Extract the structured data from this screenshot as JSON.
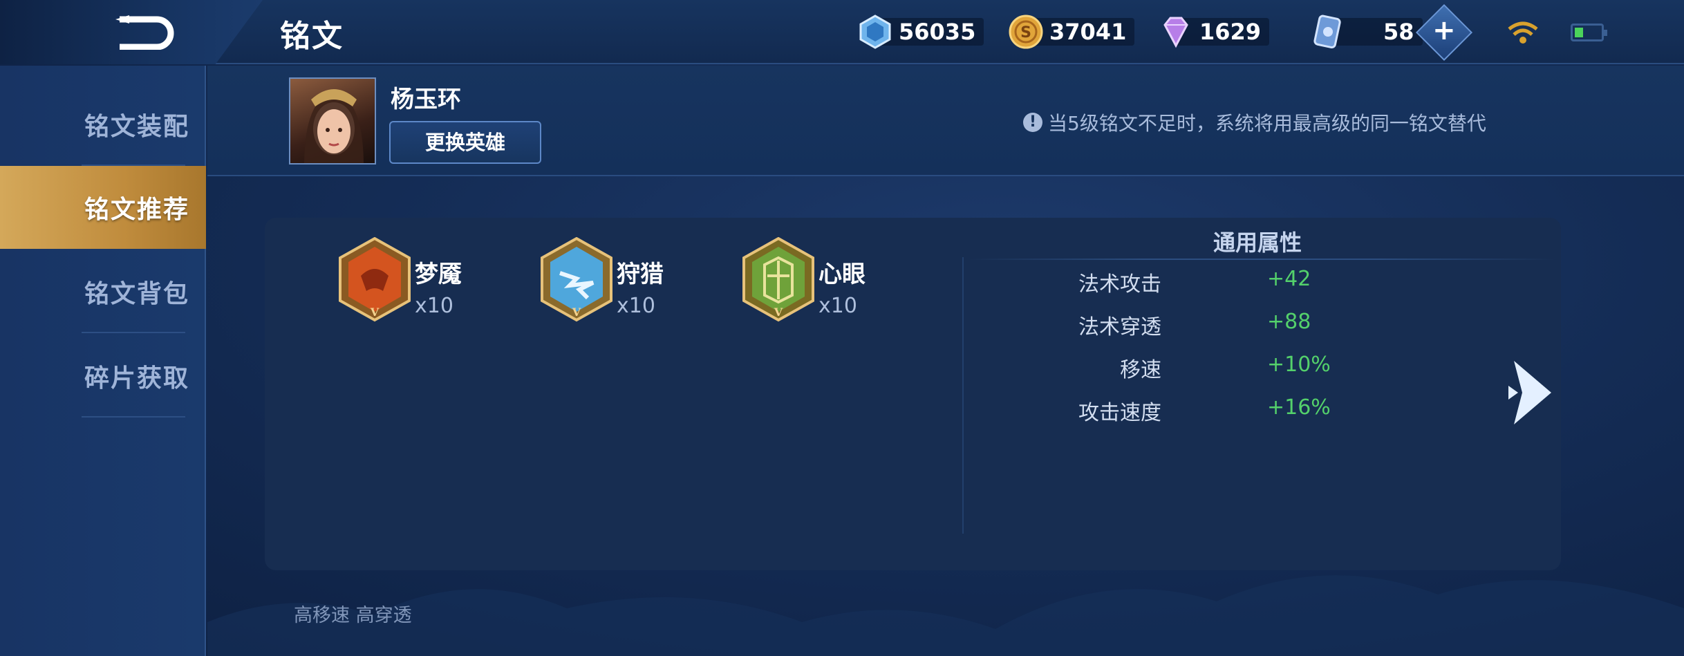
{
  "header": {
    "title": "铭文",
    "currencies": [
      {
        "icon": "diamond-crystal-icon",
        "amount": "56035"
      },
      {
        "icon": "gold-coin-icon",
        "amount": "37041"
      },
      {
        "icon": "purple-gem-icon",
        "amount": "1629"
      },
      {
        "icon": "ticket-card-icon",
        "amount": "58"
      }
    ]
  },
  "sidebar": {
    "items": [
      {
        "label": "铭文装配",
        "active": false
      },
      {
        "label": "铭文推荐",
        "active": true
      },
      {
        "label": "铭文背包",
        "active": false
      },
      {
        "label": "碎片获取",
        "active": false
      }
    ]
  },
  "hero": {
    "name": "杨玉环",
    "change_button": "更换英雄"
  },
  "notice": "当5级铭文不足时，系统将用最高级的同一铭文替代",
  "runes": [
    {
      "name": "梦魇",
      "count": "x10",
      "color": "#d4541f"
    },
    {
      "name": "狩猎",
      "count": "x10",
      "color": "#4fa7dc"
    },
    {
      "name": "心眼",
      "count": "x10",
      "color": "#6fa23a"
    }
  ],
  "attributes": {
    "title": "通用属性",
    "rows": [
      {
        "label": "法术攻击",
        "value": "+42"
      },
      {
        "label": "法术穿透",
        "value": "+88"
      },
      {
        "label": "移速",
        "value": "+10%"
      },
      {
        "label": "攻击速度",
        "value": "+16%"
      }
    ]
  },
  "tags": "高移速 高穿透",
  "colors": {
    "active_tab": "#c8964a",
    "positive_value": "#54d16b",
    "panel_bg": "#172d51"
  }
}
